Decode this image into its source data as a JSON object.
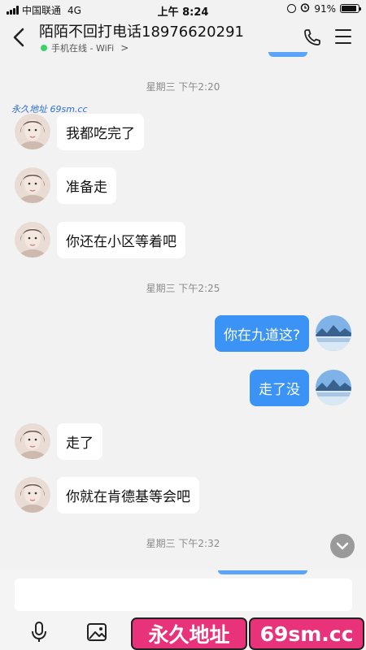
{
  "status_bar": {
    "carrier": "中国联通",
    "network": "4G",
    "time": "上午 8:24",
    "battery": "91%",
    "battery_level": 0.91
  },
  "header": {
    "title": "陌陌不回打电话18976620291",
    "subtitle": "手机在线 - WiFi",
    "subtitle_chevron": ">"
  },
  "watermark": "永久地址 69sm.cc",
  "chat": {
    "timestamps": [
      "星期三 下午2:20",
      "星期三 下午2:25",
      "星期三 下午2:32"
    ],
    "messages": [
      {
        "side": "in",
        "text": "我都吃完了"
      },
      {
        "side": "in",
        "text": "准备走"
      },
      {
        "side": "in",
        "text": "你还在小区等着吧"
      },
      {
        "side": "out",
        "text": "你在九道这?"
      },
      {
        "side": "out",
        "text": "走了没"
      },
      {
        "side": "in",
        "text": "走了"
      },
      {
        "side": "in",
        "text": "你就在肯德基等会吧"
      }
    ]
  },
  "input": {
    "placeholder": ""
  },
  "banners": [
    "永久地址",
    "69sm.cc"
  ],
  "icons": {
    "back": "chevron-left-icon",
    "phone": "phone-icon",
    "menu": "menu-icon",
    "mic": "microphone-icon",
    "image": "image-icon",
    "scroll": "chevron-down-icon"
  },
  "colors": {
    "outgoing_bubble": "#3a93f5",
    "incoming_bubble": "#ffffff",
    "background": "#f2f2f2",
    "banner": "#e8337b",
    "online": "#3cd16b"
  }
}
